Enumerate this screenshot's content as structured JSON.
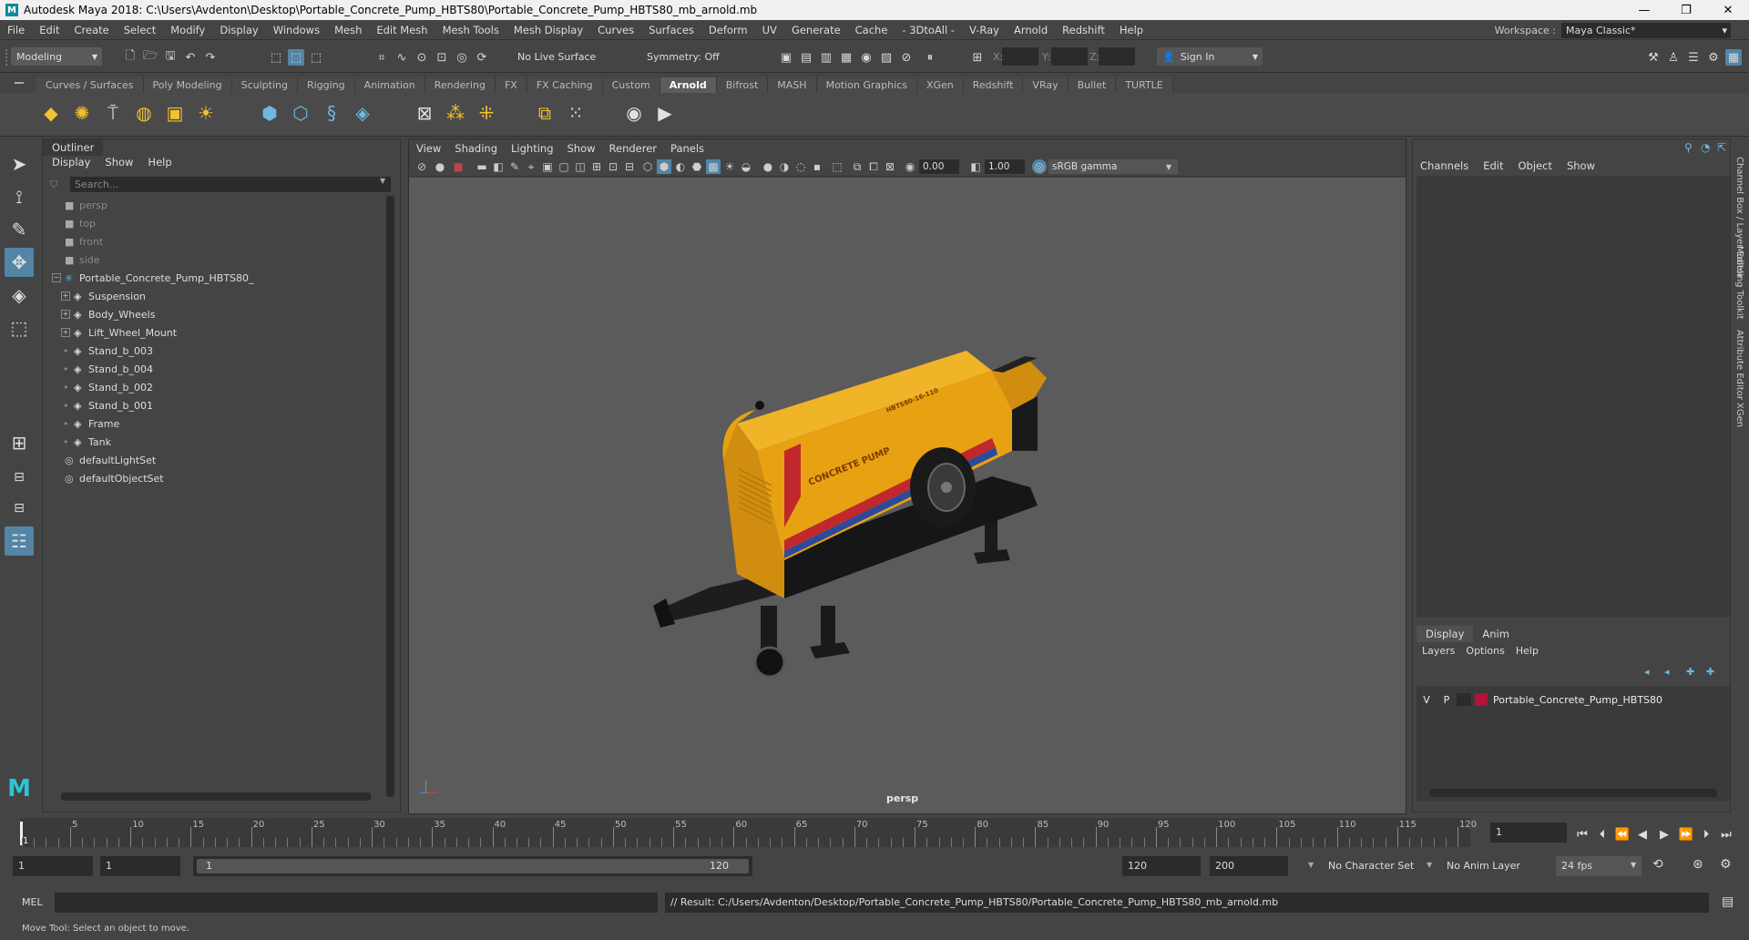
{
  "window": {
    "title": "Autodesk Maya 2018: C:\\Users\\Avdenton\\Desktop\\Portable_Concrete_Pump_HBTS80\\Portable_Concrete_Pump_HBTS80_mb_arnold.mb",
    "logo": "M",
    "minimize": "—",
    "maximize": "❐",
    "close": "✕"
  },
  "menubar": {
    "items": [
      "File",
      "Edit",
      "Create",
      "Select",
      "Modify",
      "Display",
      "Windows",
      "Mesh",
      "Edit Mesh",
      "Mesh Tools",
      "Mesh Display",
      "Curves",
      "Surfaces",
      "Deform",
      "UV",
      "Generate",
      "Cache",
      "- 3DtoAll -",
      "V-Ray",
      "Arnold",
      "Redshift",
      "Help"
    ],
    "workspace_label": "Workspace :",
    "workspace_value": "Maya Classic*"
  },
  "statusline": {
    "mode": "Modeling",
    "live_surface": "No Live Surface",
    "symmetry": "Symmetry: Off",
    "x_label": "X:",
    "y_label": "Y:",
    "z_label": "Z:",
    "sign_in": "Sign In"
  },
  "shelf": {
    "tabs": [
      "Curves / Surfaces",
      "Poly Modeling",
      "Sculpting",
      "Rigging",
      "Animation",
      "Rendering",
      "FX",
      "FX Caching",
      "Custom",
      "Arnold",
      "Bifrost",
      "MASH",
      "Motion Graphics",
      "XGen",
      "Redshift",
      "VRay",
      "Bullet",
      "TURTLE"
    ],
    "active_tab": "Arnold"
  },
  "outliner": {
    "title": "Outliner",
    "menu": [
      "Display",
      "Show",
      "Help"
    ],
    "search_placeholder": "Search...",
    "items": [
      {
        "label": "persp",
        "type": "camera",
        "dim": true,
        "depth": 0
      },
      {
        "label": "top",
        "type": "camera",
        "dim": true,
        "depth": 0
      },
      {
        "label": "front",
        "type": "camera",
        "dim": true,
        "depth": 0
      },
      {
        "label": "side",
        "type": "camera",
        "dim": true,
        "depth": 0
      },
      {
        "label": "Portable_Concrete_Pump_HBTS80_",
        "type": "group",
        "dim": false,
        "depth": 0
      },
      {
        "label": "Suspension",
        "type": "mesh",
        "dim": false,
        "depth": 1
      },
      {
        "label": "Body_Wheels",
        "type": "mesh",
        "dim": false,
        "depth": 1
      },
      {
        "label": "Lift_Wheel_Mount",
        "type": "mesh",
        "dim": false,
        "depth": 1
      },
      {
        "label": "Stand_b_003",
        "type": "mesh",
        "dim": false,
        "depth": 1
      },
      {
        "label": "Stand_b_004",
        "type": "mesh",
        "dim": false,
        "depth": 1
      },
      {
        "label": "Stand_b_002",
        "type": "mesh",
        "dim": false,
        "depth": 1
      },
      {
        "label": "Stand_b_001",
        "type": "mesh",
        "dim": false,
        "depth": 1
      },
      {
        "label": "Frame",
        "type": "mesh",
        "dim": false,
        "depth": 1
      },
      {
        "label": "Tank",
        "type": "mesh",
        "dim": false,
        "depth": 1
      },
      {
        "label": "defaultLightSet",
        "type": "set",
        "dim": false,
        "depth": 0
      },
      {
        "label": "defaultObjectSet",
        "type": "set",
        "dim": false,
        "depth": 0
      }
    ]
  },
  "viewport": {
    "menu": [
      "View",
      "Shading",
      "Lighting",
      "Show",
      "Renderer",
      "Panels"
    ],
    "exposure": "0.00",
    "gamma": "1.00",
    "color_space": "sRGB gamma",
    "camera_label": "persp",
    "model_text_1": "CONCRETE PUMP",
    "model_text_2": "HBTS80-16-110",
    "colors": {
      "body": "#e8a112",
      "stripe_red": "#c0282d",
      "stripe_blue": "#2c4a9a",
      "chassis": "#1a1a1a"
    }
  },
  "channelbox": {
    "menu": [
      "Channels",
      "Edit",
      "Object",
      "Show"
    ],
    "layer_tabs": [
      "Display",
      "Anim"
    ],
    "layer_menu": [
      "Layers",
      "Options",
      "Help"
    ],
    "layer": {
      "v": "V",
      "p": "P",
      "name": "Portable_Concrete_Pump_HBTS80",
      "color": "#b3123a"
    }
  },
  "sidetabs": [
    "Channel Box / Layer Editor",
    "Modeling Toolkit",
    "Attribute Editor",
    "XGen"
  ],
  "timeline": {
    "ticks": [
      "5",
      "10",
      "15",
      "20",
      "25",
      "30",
      "35",
      "40",
      "45",
      "50",
      "55",
      "60",
      "65",
      "70",
      "75",
      "80",
      "85",
      "90",
      "95",
      "100",
      "105",
      "110",
      "115",
      "120"
    ],
    "start_label": "1",
    "current_frame": "1"
  },
  "range": {
    "start": "1",
    "start2": "1",
    "range_start": "1",
    "range_end": "120",
    "end": "120",
    "end2": "200",
    "character_set": "No Character Set",
    "anim_layer": "No Anim Layer",
    "fps": "24 fps"
  },
  "cmdline": {
    "mode": "MEL",
    "result": "// Result: C:/Users/Avdenton/Desktop/Portable_Concrete_Pump_HBTS80/Portable_Concrete_Pump_HBTS80_mb_arnold.mb"
  },
  "helpline": {
    "text": "Move Tool: Select an object to move."
  }
}
